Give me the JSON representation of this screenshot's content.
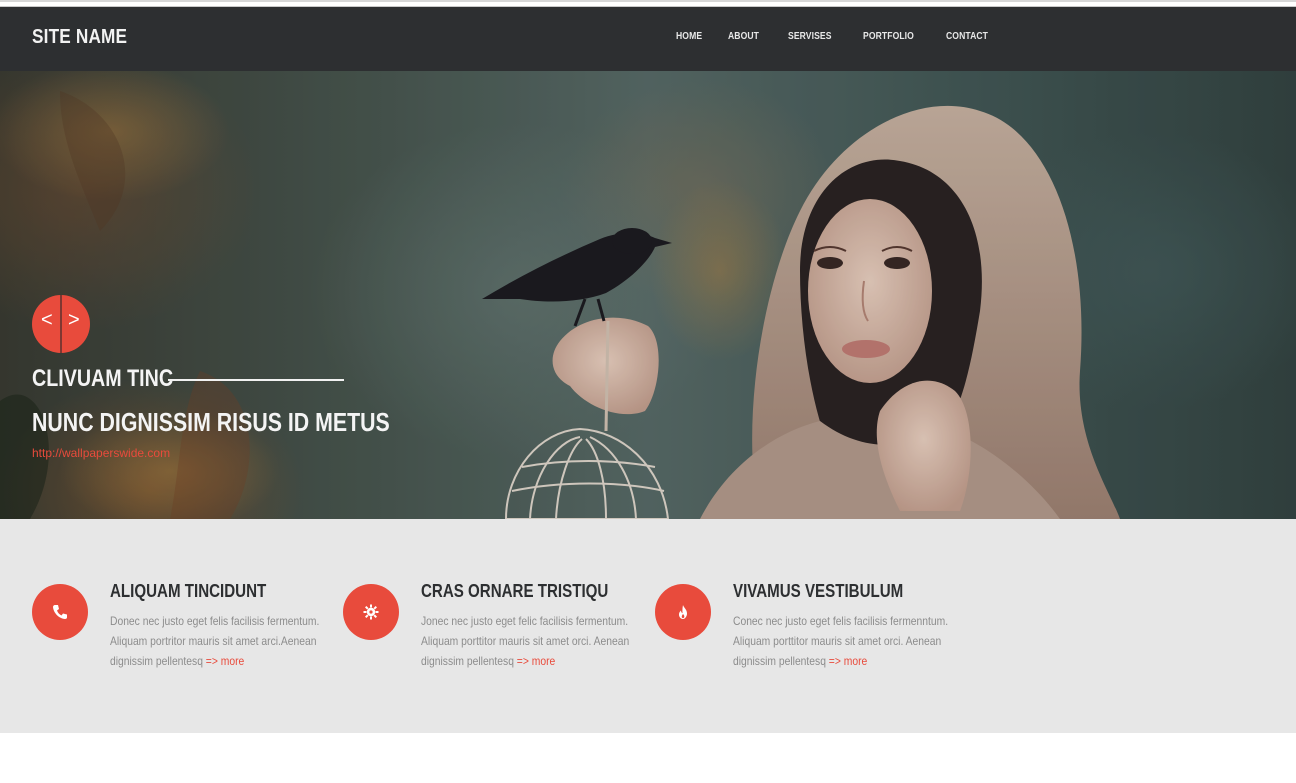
{
  "header": {
    "site_name": "SITE NAME",
    "nav": [
      "HOME",
      "ABOUT",
      "SERVISES",
      "PORTFOLIO",
      "CONTACT"
    ]
  },
  "hero": {
    "badge": {
      "left": "<",
      "right": ">",
      "icon": "code-icon"
    },
    "subtitle": "CLIVUAM TINC",
    "title": "NUNC DIGNISSIM RISUS ID METUS",
    "link": "http://wallpaperswide.com"
  },
  "features": [
    {
      "icon": "phone-icon",
      "title": "ALIQUAM TINCIDUNT",
      "lines": [
        "Donec nec justo eget felis facilisis fermentum.",
        "Aliquam portritor mauris sit amet arci.Aenean",
        "dignissim pellentesq"
      ],
      "arrow": "=>",
      "more": "more"
    },
    {
      "icon": "gear-icon",
      "title": "CRAS ORNARE TRISTIQU",
      "lines": [
        "Jonec nec justo eget felic facilisis fermentum.",
        "Aliquam porttitor mauris sit amet orci. Aenean",
        "dignissim pellentesq"
      ],
      "arrow": "=>",
      "more": "more"
    },
    {
      "icon": "flame-icon",
      "title": "VIVAMUS VESTIBULUM",
      "lines": [
        "Conec nec justo eget felis facilisis fermenntum.",
        "Aliquam porttitor mauris sit amet orci. Aenean",
        "dignissim pellentesq"
      ],
      "arrow": "=>",
      "more": "more"
    }
  ],
  "colors": {
    "accent": "#e84b3c",
    "navbar": "#2d2f31",
    "features_bg": "#e7e7e7"
  }
}
